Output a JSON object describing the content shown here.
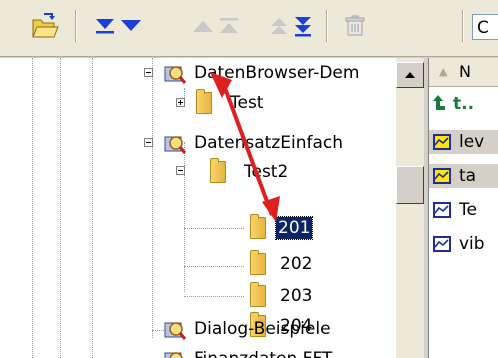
{
  "toolbar": {
    "buttons": [
      {
        "name": "open-folder-icon"
      },
      {
        "name": "move-to-bottom-icon"
      },
      {
        "name": "move-down-icon"
      },
      {
        "name": "move-up-icon"
      },
      {
        "name": "move-to-top-icon"
      },
      {
        "name": "move-up-one-icon"
      },
      {
        "name": "move-to-end-icon"
      },
      {
        "name": "delete-icon"
      }
    ],
    "combo_value": "C"
  },
  "tree": {
    "nodes": [
      {
        "label": "DatenBrowser-Dem",
        "icon": "database-icon"
      },
      {
        "label": "Test",
        "icon": "folder-icon"
      },
      {
        "label": "DatensatzEinfach",
        "icon": "database-icon"
      },
      {
        "label": "Test2",
        "icon": "folder-icon"
      },
      {
        "label": "201",
        "icon": "folder-icon",
        "selected": true
      },
      {
        "label": "202",
        "icon": "folder-icon"
      },
      {
        "label": "203",
        "icon": "folder-icon"
      },
      {
        "label": "204",
        "icon": "folder-icon"
      },
      {
        "label": "Dialog-Beispiele",
        "icon": "database-icon"
      },
      {
        "label": "Finanzdaten FFT",
        "icon": "database-icon"
      }
    ]
  },
  "list": {
    "column_header": "N",
    "items": [
      {
        "label": "t..",
        "icon": "up-arrow-icon"
      },
      {
        "label": "lev",
        "icon": "chart-icon",
        "highlight": true
      },
      {
        "label": "ta",
        "icon": "chart-icon",
        "highlight": true
      },
      {
        "label": "Te",
        "icon": "chart-icon"
      },
      {
        "label": "vib",
        "icon": "chart-icon"
      }
    ]
  },
  "colors": {
    "selection": "#0a246a",
    "toolbar_arrow": "#1e3fd6",
    "annotation_arrow": "#e02020"
  }
}
